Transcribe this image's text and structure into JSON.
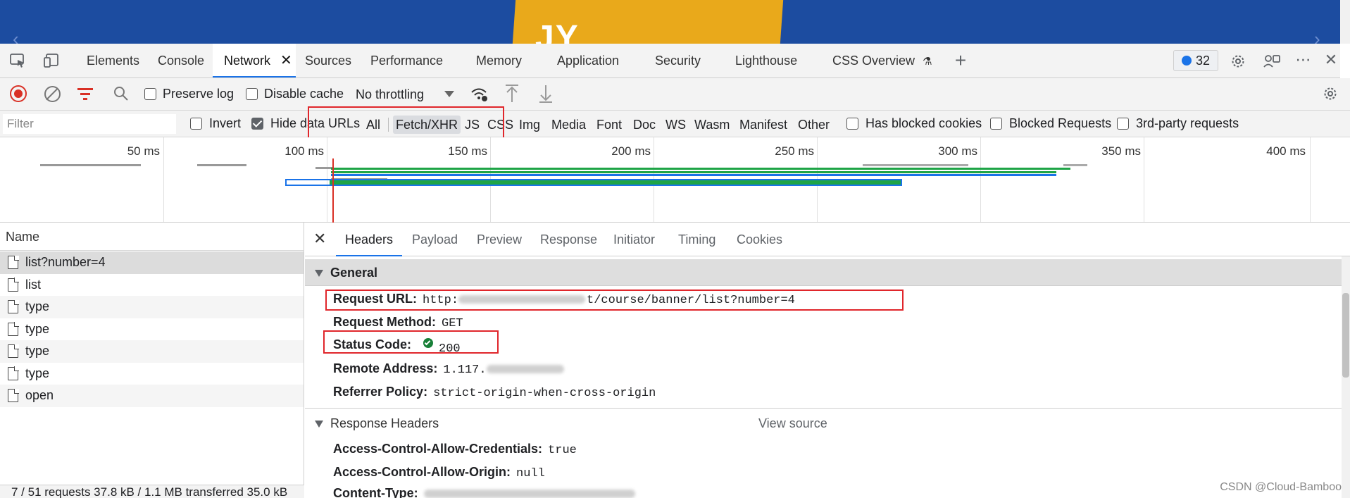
{
  "devtools": {
    "tabs": [
      "Elements",
      "Console",
      "Network",
      "Sources",
      "Performance",
      "Memory",
      "Application",
      "Security",
      "Lighthouse",
      "CSS Overview"
    ],
    "active_tab": "Network",
    "issues_count": "32"
  },
  "toolbar": {
    "preserve_log": "Preserve log",
    "disable_cache": "Disable cache",
    "throttling": "No throttling"
  },
  "filter": {
    "placeholder": "Filter",
    "invert": "Invert",
    "hide_data_urls": "Hide data URLs",
    "types": [
      "All",
      "Fetch/XHR",
      "JS",
      "CSS",
      "Img",
      "Media",
      "Font",
      "Doc",
      "WS",
      "Wasm",
      "Manifest",
      "Other"
    ],
    "active_type": "Fetch/XHR",
    "has_blocked_cookies": "Has blocked cookies",
    "blocked_requests": "Blocked Requests",
    "third_party": "3rd-party requests"
  },
  "timeline": {
    "ticks": [
      "50 ms",
      "100 ms",
      "150 ms",
      "200 ms",
      "250 ms",
      "300 ms",
      "350 ms",
      "400 ms"
    ]
  },
  "requests": {
    "header": "Name",
    "items": [
      "list?number=4",
      "list",
      "type",
      "type",
      "type",
      "type",
      "open"
    ],
    "status": "7 / 51 requests  37.8 kB / 1.1 MB transferred  35.0 kB"
  },
  "details": {
    "tabs": [
      "Headers",
      "Payload",
      "Preview",
      "Response",
      "Initiator",
      "Timing",
      "Cookies"
    ],
    "active_tab": "Headers",
    "general": {
      "title": "General",
      "request_url_key": "Request URL:",
      "request_url_prefix": "http:",
      "request_url_suffix": "t/course/banner/list?number=4",
      "request_method_key": "Request Method:",
      "request_method": "GET",
      "status_code_key": "Status Code:",
      "status_code": "200",
      "remote_address_key": "Remote Address:",
      "remote_address": "1.117.",
      "referrer_policy_key": "Referrer Policy:",
      "referrer_policy": "strict-origin-when-cross-origin"
    },
    "response_headers": {
      "title": "Response Headers",
      "view_source": "View source",
      "acac_key": "Access-Control-Allow-Credentials:",
      "acac": "true",
      "acao_key": "Access-Control-Allow-Origin:",
      "acao": "null",
      "content_type_key": "Content-Type:"
    }
  },
  "banner": {
    "logo": "JY"
  },
  "watermark": "CSDN @Cloud-Bamboo",
  "colors": {
    "accent": "#1a73e8",
    "record": "#d93025",
    "highlight": "#e0262b",
    "status_ok": "#188038"
  }
}
